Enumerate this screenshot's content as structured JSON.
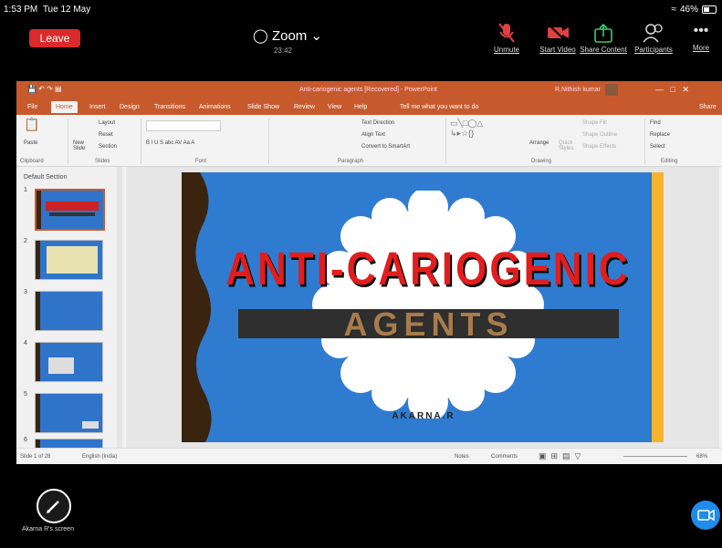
{
  "status": {
    "time": "1:53 PM",
    "date": "Tue 12 May",
    "battery": "46%"
  },
  "zoom": {
    "leave": "Leave",
    "title": "Zoom",
    "chev": "⌄",
    "elapsed": "23:42",
    "controls": [
      {
        "label": "Unmute"
      },
      {
        "label": "Start Video"
      },
      {
        "label": "Share Content"
      },
      {
        "label": "Participants"
      },
      {
        "label": "More"
      }
    ],
    "share_label": "Akarna R's screen"
  },
  "ppt": {
    "window_title": "Anti-cariogenic agents [Recovered]  -  PowerPoint",
    "user": "R.Nithish kumar",
    "tabs": [
      "File",
      "Home",
      "Insert",
      "Design",
      "Transitions",
      "Animations",
      "Slide Show",
      "Review",
      "View",
      "Help",
      "Tell me what you want to do",
      "Share"
    ],
    "ribbon": {
      "paste": "Paste",
      "new_slide": "New Slide",
      "layout": "Layout",
      "reset": "Reset",
      "section": "Section",
      "groups": [
        "Clipboard",
        "Slides",
        "Font",
        "Paragraph",
        "Drawing",
        "Editing"
      ],
      "text_direction": "Text Direction",
      "align_text": "Align Text",
      "smartart": "Convert to SmartArt",
      "arrange": "Arrange",
      "quick_styles": "Quick Styles",
      "shape_fill": "Shape Fill",
      "shape_outline": "Shape Outline",
      "shape_effects": "Shape Effects",
      "find": "Find",
      "replace": "Replace",
      "select": "Select",
      "font_tools": "B  I  U  S  abc  AV  Aa  A"
    },
    "pane_title": "Default Section",
    "thumb_numbers": [
      "1",
      "2",
      "3",
      "4",
      "5",
      "6"
    ],
    "slide": {
      "title1": "ANTI-CARIOGENIC",
      "title2": "AGENTS",
      "author": "AKARNA.R"
    },
    "statusbar": {
      "slide_of": "Slide 1 of 28",
      "language": "English (India)",
      "notes": "Notes",
      "comments": "Comments",
      "zoom": "68%"
    }
  }
}
